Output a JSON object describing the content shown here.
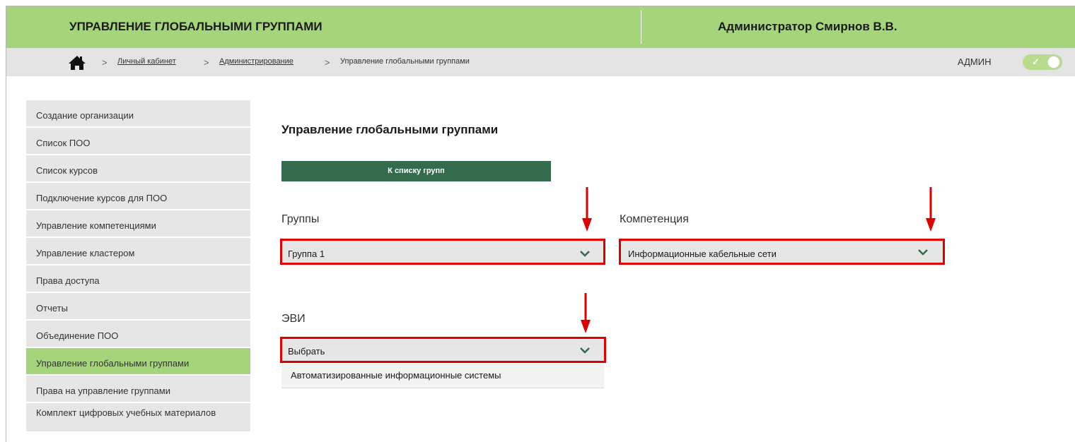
{
  "header": {
    "title": "УПРАВЛЕНИЕ ГЛОБАЛЬНЫМИ ГРУППАМИ",
    "user": "Администратор Смирнов В.В."
  },
  "breadcrumb": {
    "home_icon": "home-icon",
    "links": [
      "Личный кабинет",
      "Администрирование"
    ],
    "current": "Управление глобальными группами",
    "separator": ">"
  },
  "role": {
    "label": "АДМИН",
    "toggle_on": true,
    "toggle_check": "✓"
  },
  "sidebar": {
    "items": [
      {
        "label": "Создание организации"
      },
      {
        "label": "Список ПОО"
      },
      {
        "label": "Список курсов"
      },
      {
        "label": "Подключение курсов для ПОО"
      },
      {
        "label": "Управление компетенциями"
      },
      {
        "label": "Управление кластером"
      },
      {
        "label": "Права доступа"
      },
      {
        "label": "Отчеты"
      },
      {
        "label": "Объединение ПОО"
      },
      {
        "label": "Управление глобальными группами"
      },
      {
        "label": "Права на управление группами"
      },
      {
        "label": "Комплект цифровых учебных материалов"
      }
    ],
    "active_index": 9
  },
  "main": {
    "title": "Управление глобальными группами",
    "back_button": "К списку групп",
    "groups": {
      "label": "Группы",
      "value": "Группа 1"
    },
    "competence": {
      "label": "Компетенция",
      "value": "Информационные кабельные сети"
    },
    "evi": {
      "label": "ЭВИ",
      "value": "Выбрать",
      "options": [
        "Автоматизированные информационные системы"
      ]
    }
  },
  "colors": {
    "header_green": "#a5d57a",
    "button_dark_green": "#356b4d",
    "highlight_red": "#e00000",
    "chevron_green": "#356b4d"
  }
}
